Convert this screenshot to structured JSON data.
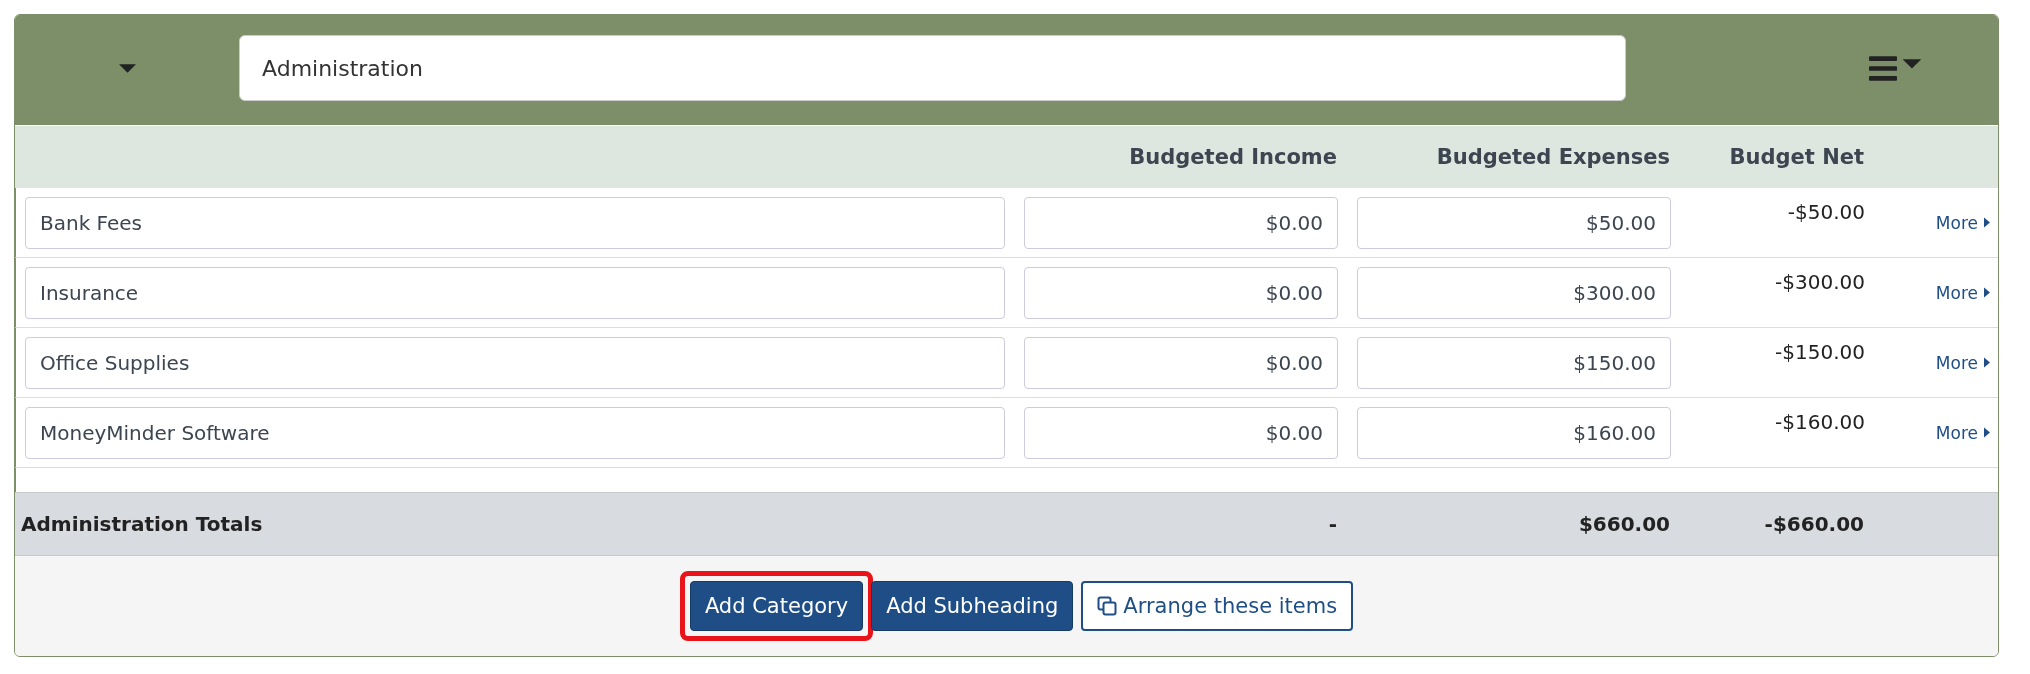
{
  "group": {
    "name": "Administration",
    "collapsed": false
  },
  "columns": [
    "Budgeted Income",
    "Budgeted Expenses",
    "Budget Net"
  ],
  "rows": [
    {
      "name": "Bank Fees",
      "income": "$0.00",
      "expenses": "$50.00",
      "net": "-$50.00",
      "more": "More"
    },
    {
      "name": "Insurance",
      "income": "$0.00",
      "expenses": "$300.00",
      "net": "-$300.00",
      "more": "More"
    },
    {
      "name": "Office Supplies",
      "income": "$0.00",
      "expenses": "$150.00",
      "net": "-$150.00",
      "more": "More"
    },
    {
      "name": "MoneyMinder Software",
      "income": "$0.00",
      "expenses": "$160.00",
      "net": "-$160.00",
      "more": "More"
    }
  ],
  "totals": {
    "label": "Administration Totals",
    "income": "-",
    "expenses": "$660.00",
    "net": "-$660.00"
  },
  "buttons": [
    {
      "label": "Add Category",
      "kind": "primary",
      "highlighted": true
    },
    {
      "label": "Add Subheading",
      "kind": "primary",
      "highlighted": false
    },
    {
      "label": "Arrange these items",
      "kind": "outline",
      "highlighted": false
    }
  ]
}
